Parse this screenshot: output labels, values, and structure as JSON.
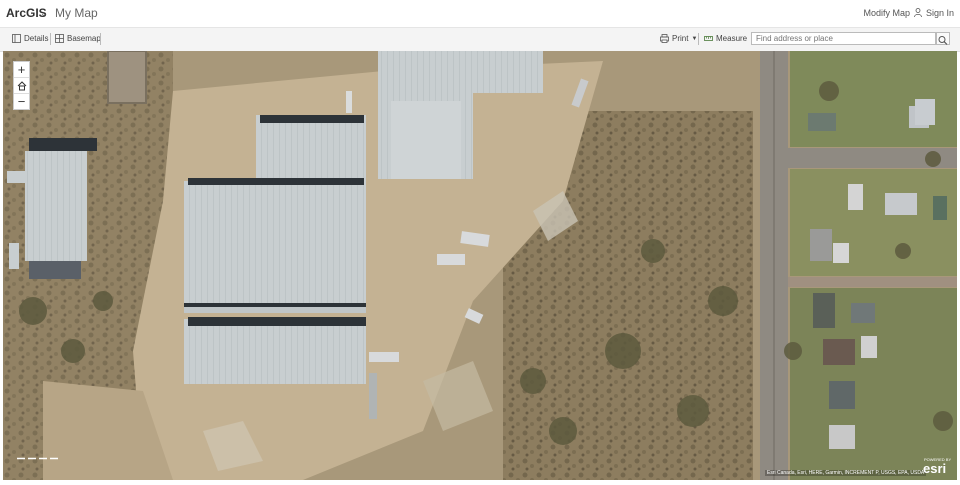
{
  "header": {
    "brand": "ArcGIS",
    "map_title": "My Map",
    "modify_label": "Modify Map",
    "signin_label": "Sign In"
  },
  "toolbar": {
    "details_label": "Details",
    "basemap_label": "Basemap",
    "print_label": "Print",
    "measure_label": "Measure"
  },
  "search": {
    "placeholder": "Find address or place"
  },
  "map": {
    "zoom_in": "+",
    "zoom_out": "−",
    "attribution": "Esri Canada, Esri, HERE, Garmin, INCREMENT P, USGS, EPA, USDA",
    "logo_powered": "POWERED BY",
    "logo": "esri"
  }
}
